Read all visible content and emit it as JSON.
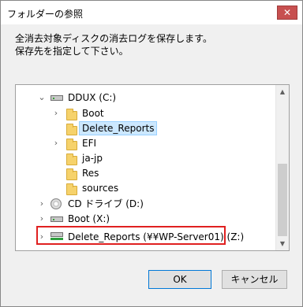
{
  "window": {
    "title": "フォルダーの参照",
    "close_label": "✕"
  },
  "description": {
    "line1": "全消去対象ディスクの消去ログを保存します。",
    "line2": "保存先を指定して下さい。"
  },
  "tree": {
    "items": [
      {
        "label": "DDUX (C:)",
        "chevron": "⌄"
      },
      {
        "label": "Boot",
        "chevron": "›"
      },
      {
        "label": "Delete_Reports",
        "chevron": ""
      },
      {
        "label": "EFI",
        "chevron": "›"
      },
      {
        "label": "ja-jp",
        "chevron": ""
      },
      {
        "label": "Res",
        "chevron": ""
      },
      {
        "label": "sources",
        "chevron": ""
      },
      {
        "label": "CD ドライブ (D:)",
        "chevron": "›"
      },
      {
        "label": "Boot (X:)",
        "chevron": "›"
      },
      {
        "label": "Delete_Reports (¥¥WP-Server01) (Z:)",
        "chevron": "›"
      }
    ],
    "scroll_up": "▲",
    "scroll_down": "▼"
  },
  "buttons": {
    "ok": "OK",
    "cancel": "キャンセル"
  }
}
